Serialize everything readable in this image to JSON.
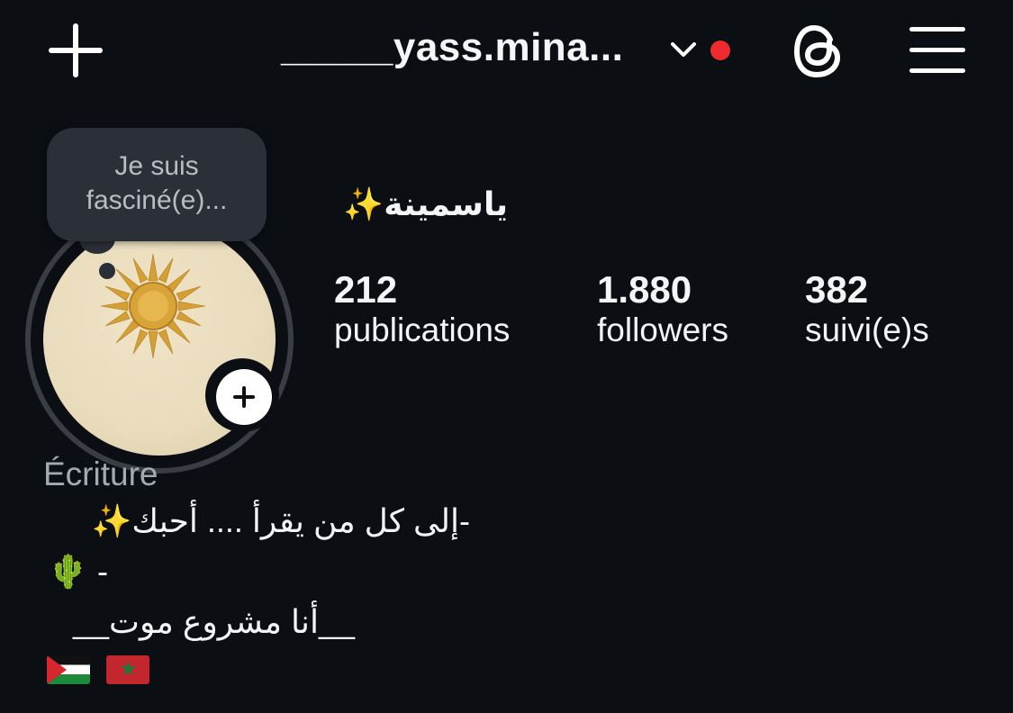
{
  "header": {
    "username": "_____yass.mina...",
    "icons": {
      "new_post": "plus-icon",
      "switch_account": "chevron-down-icon",
      "notification": "red-dot",
      "threads": "threads-icon",
      "menu": "hamburger-menu-icon"
    },
    "colors": {
      "background": "#0b0e13",
      "notification_dot": "#ef2b2d"
    }
  },
  "note": {
    "line1": "Je suis",
    "line2": "fasciné(e)..."
  },
  "profile": {
    "display_name": "ياسمينة✨",
    "avatar": "golden-sun-avatar",
    "stats": [
      {
        "value": "212",
        "label": "publications"
      },
      {
        "value": "1.880",
        "label": "followers"
      },
      {
        "value": "382",
        "label": "suivi(e)s"
      }
    ]
  },
  "bio": {
    "category": "Écriture",
    "lines": [
      "-إلى كل من يقرأ .... أحبك✨",
      "- 🌵",
      "__أنا مشروع موت__"
    ],
    "flags": [
      "palestine-flag",
      "morocco-flag"
    ]
  }
}
